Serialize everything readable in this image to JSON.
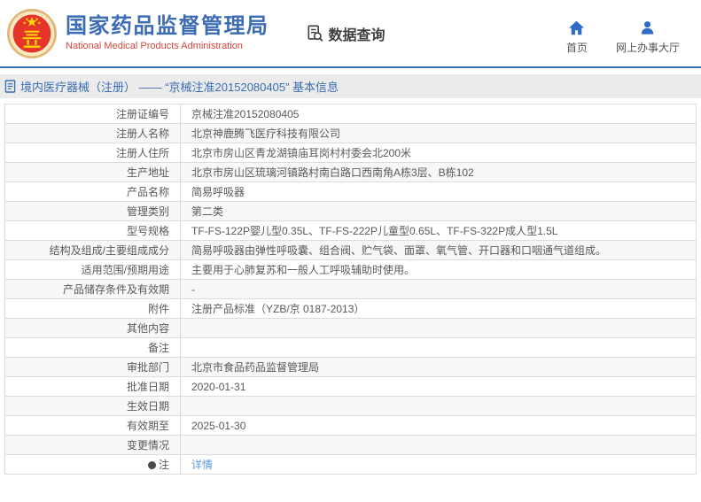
{
  "header": {
    "agency_name_cn": "国家药品监督管理局",
    "agency_name_en": "National Medical Products Administration",
    "data_query": "数据查询",
    "nav_home": "首页",
    "nav_hall": "网上办事大厅"
  },
  "breadcrumb": "境内医疗器械（注册） —— “京械注准20152080405” 基本信息",
  "table": {
    "rows": [
      {
        "label": "注册证编号",
        "value": "京械注准20152080405"
      },
      {
        "label": "注册人名称",
        "value": "北京神鹿腾飞医疗科技有限公司"
      },
      {
        "label": "注册人住所",
        "value": "北京市房山区青龙湖镇庙耳岗村村委会北200米"
      },
      {
        "label": "生产地址",
        "value": "北京市房山区琉璃河镇路村南白路口西南角A栋3层、B栋102"
      },
      {
        "label": "产品名称",
        "value": "简易呼吸器"
      },
      {
        "label": "管理类别",
        "value": "第二类"
      },
      {
        "label": "型号规格",
        "value": "TF-FS-122P婴儿型0.35L、TF-FS-222P儿童型0.65L、TF-FS-322P成人型1.5L"
      },
      {
        "label": "结构及组成/主要组成成分",
        "value": "简易呼吸器由弹性呼吸囊、组合阀、贮气袋、面罩、氧气管、开口器和口咽通气道组成。"
      },
      {
        "label": "适用范围/预期用途",
        "value": "主要用于心肺复苏和一般人工呼吸辅助时使用。"
      },
      {
        "label": "产品储存条件及有效期",
        "value": "-"
      },
      {
        "label": "附件",
        "value": "注册产品标准（YZB/京 0187-2013）"
      },
      {
        "label": "其他内容",
        "value": ""
      },
      {
        "label": "备注",
        "value": ""
      },
      {
        "label": "审批部门",
        "value": "北京市食品药品监督管理局"
      },
      {
        "label": "批准日期",
        "value": "2020-01-31"
      },
      {
        "label": "生效日期",
        "value": ""
      },
      {
        "label": "有效期至",
        "value": "2025-01-30"
      },
      {
        "label": "变更情况",
        "value": ""
      },
      {
        "label": "注",
        "value": "详情",
        "label_icon": "note-icon",
        "value_is_link": true
      }
    ]
  },
  "colors": {
    "brand_blue": "#3c6cb4",
    "brand_red": "#d5463d",
    "link_blue": "#5b9bd5",
    "stripe_gray": "#f7f7f7",
    "border_gray": "#dcdcdc"
  }
}
